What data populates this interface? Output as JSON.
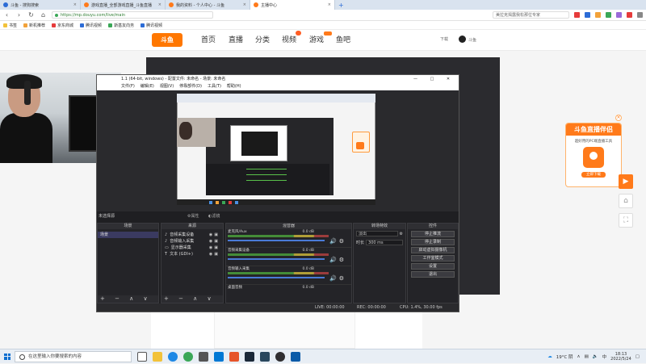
{
  "browser": {
    "tabs": [
      {
        "label": "斗鱼 - 搜狗搜索",
        "active": false
      },
      {
        "label": "游戏直播_全部游戏直播_斗鱼直播",
        "active": false
      },
      {
        "label": "我的资料 - 个人中心 - 斗鱼",
        "active": false
      },
      {
        "label": "主播中心",
        "active": true
      }
    ],
    "url": "https://mp.douyu.com/live/main",
    "search_placeholder": "美拉克揭露我松那位专家",
    "bookmarks": [
      "书签",
      "新机推荐",
      "京东商城",
      "腾讯视频",
      "斯基友向务",
      "腾讯视频"
    ]
  },
  "douyu": {
    "logo_text": "斗鱼",
    "nav": [
      "首页",
      "直播",
      "分类",
      "视频",
      "游戏",
      "鱼吧"
    ],
    "download_label": "下载",
    "username": "斗鱼"
  },
  "obs": {
    "title": "1.1 (64-bit, windows) - 配置文件: 未命名 - 场景: 未命名",
    "menu": [
      "文件(F)",
      "编辑(E)",
      "视图(V)",
      "停靠部件(D)",
      "工具(T)",
      "帮助(H)"
    ],
    "window_buttons": "— □ ✕",
    "no_source_selected": "未选择源",
    "properties_label": "属性",
    "filters_label": "滤镜",
    "docks": {
      "scenes_title": "场景",
      "sources_title": "来源",
      "mixer_title": "混音器",
      "transitions_title": "转场特效",
      "controls_title": "控件"
    },
    "scenes": [
      "场景"
    ],
    "sources": [
      {
        "label": "音频采集设备",
        "icon": "speaker-icon"
      },
      {
        "label": "音频输入采集",
        "icon": "mic-icon"
      },
      {
        "label": "显示器采集",
        "icon": "monitor-icon"
      },
      {
        "label": "文本 (GDI+)",
        "icon": "text-icon"
      }
    ],
    "mixer": [
      {
        "name": "麦克风/Aux",
        "db": "0.0 dB"
      },
      {
        "name": "音频采集设备",
        "db": "0.0 dB"
      },
      {
        "name": "音频输入采集",
        "db": "0.0 dB"
      },
      {
        "name": "桌面音频",
        "db": "0.0 dB"
      }
    ],
    "transition": {
      "type": "淡出",
      "duration_label": "时长",
      "duration_value": "300 ms"
    },
    "controls": [
      "停止推流",
      "停止录制",
      "启动虚拟摄像机",
      "工作室模式",
      "设置",
      "退出"
    ],
    "status": {
      "live": "LIVE: 00:00:00",
      "rec": "REC: 00:00:00",
      "cpu": "CPU: 1.4%, 30.00 fps"
    },
    "dock_footer_buttons": "+ − ∧ ∨"
  },
  "promo": {
    "title": "斗鱼直播伴侣",
    "subtitle": "超好用的PC端直播工具",
    "brand": "DOUYU",
    "button": "立即下载"
  },
  "taskbar": {
    "search_placeholder": "在这里输入你要搜索的内容",
    "weather": "19°C 阴",
    "time": "18:13",
    "date": "2022/5/24"
  },
  "colors": {
    "accent": "#ff7a1a",
    "obs_bg": "#1f1f22",
    "link_green": "#2e7d32"
  }
}
